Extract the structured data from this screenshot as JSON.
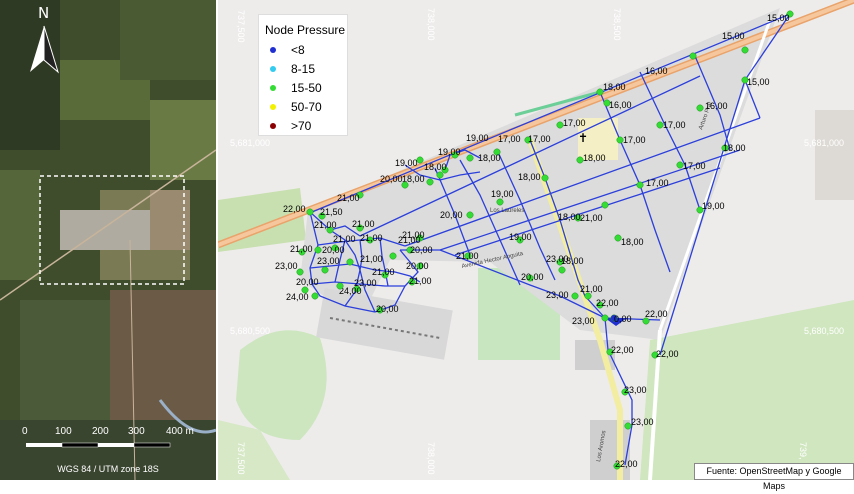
{
  "overview": {
    "north_label": "N",
    "scale_ticks": [
      "0",
      "100",
      "200",
      "300",
      "400 m"
    ],
    "crs_label": "WGS 84 / UTM zone 18S"
  },
  "legend": {
    "title": "Node Pressure",
    "items": [
      {
        "label": "<8",
        "color": "#1f2fd1"
      },
      {
        "label": "8-15",
        "color": "#33ccee"
      },
      {
        "label": "15-50",
        "color": "#33dd33"
      },
      {
        "label": "50-70",
        "color": "#f2f200"
      },
      {
        "label": ">70",
        "color": "#8b0000"
      }
    ]
  },
  "grid_labels": {
    "top": [
      "737,500",
      "738,000",
      "738,500"
    ],
    "bottom": [
      "737,500",
      "738,000",
      "739,"
    ],
    "left": [
      "5,681,000",
      "5,680,500"
    ],
    "right": [
      "5,681,000",
      "5,680,500"
    ]
  },
  "street_labels": [
    "Avenida Hector Anguita",
    "Arturo Prat",
    "Los Laureles",
    "Los Aromos"
  ],
  "nodes": [
    {
      "label": "15,00"
    },
    {
      "label": "15,00"
    },
    {
      "label": "16,00"
    },
    {
      "label": "15,00"
    },
    {
      "label": "18,00"
    },
    {
      "label": "16,00"
    },
    {
      "label": "16,00"
    },
    {
      "label": "17,00"
    },
    {
      "label": "17,00"
    },
    {
      "label": "17,00"
    },
    {
      "label": "17,00"
    },
    {
      "label": "17,00"
    },
    {
      "label": "18,00"
    },
    {
      "label": "19,00"
    },
    {
      "label": "18,00"
    },
    {
      "label": "19,00"
    },
    {
      "label": "18,00"
    },
    {
      "label": "19,00"
    },
    {
      "label": "18,00"
    },
    {
      "label": "18,00"
    },
    {
      "label": "17,00"
    },
    {
      "label": "17,00"
    },
    {
      "label": "18,00"
    },
    {
      "label": "20,00"
    },
    {
      "label": "21,00"
    },
    {
      "label": "19,00"
    },
    {
      "label": "19,00"
    },
    {
      "label": "22,00"
    },
    {
      "label": "21,50"
    },
    {
      "label": "20,00"
    },
    {
      "label": "18,00"
    },
    {
      "label": "21,00"
    },
    {
      "label": "21,00"
    },
    {
      "label": "21,00"
    },
    {
      "label": "21,00"
    },
    {
      "label": "19,00"
    },
    {
      "label": "18,00"
    },
    {
      "label": "21,00"
    },
    {
      "label": "21,00"
    },
    {
      "label": "20,00"
    },
    {
      "label": "21,00"
    },
    {
      "label": "21,00"
    },
    {
      "label": "21,00"
    },
    {
      "label": "20,00"
    },
    {
      "label": "23,00"
    },
    {
      "label": "21,00"
    },
    {
      "label": "20,00"
    },
    {
      "label": "18,00"
    },
    {
      "label": "23,00"
    },
    {
      "label": "23,00"
    },
    {
      "label": "21,00"
    },
    {
      "label": "20,00"
    },
    {
      "label": "20,00"
    },
    {
      "label": "21,00"
    },
    {
      "label": "24,00"
    },
    {
      "label": "24,00"
    },
    {
      "label": "23,00"
    },
    {
      "label": "23,00"
    },
    {
      "label": "22,00"
    },
    {
      "label": "21,00"
    },
    {
      "label": "22,00"
    },
    {
      "label": "20,00"
    },
    {
      "label": "23,00"
    },
    {
      "label": "0,00"
    },
    {
      "label": "22,00"
    },
    {
      "label": "22,00"
    },
    {
      "label": "23,00"
    },
    {
      "label": "23,00"
    },
    {
      "label": "22,00"
    }
  ],
  "source": "Fuente: OpenStreetMap y Google Maps"
}
